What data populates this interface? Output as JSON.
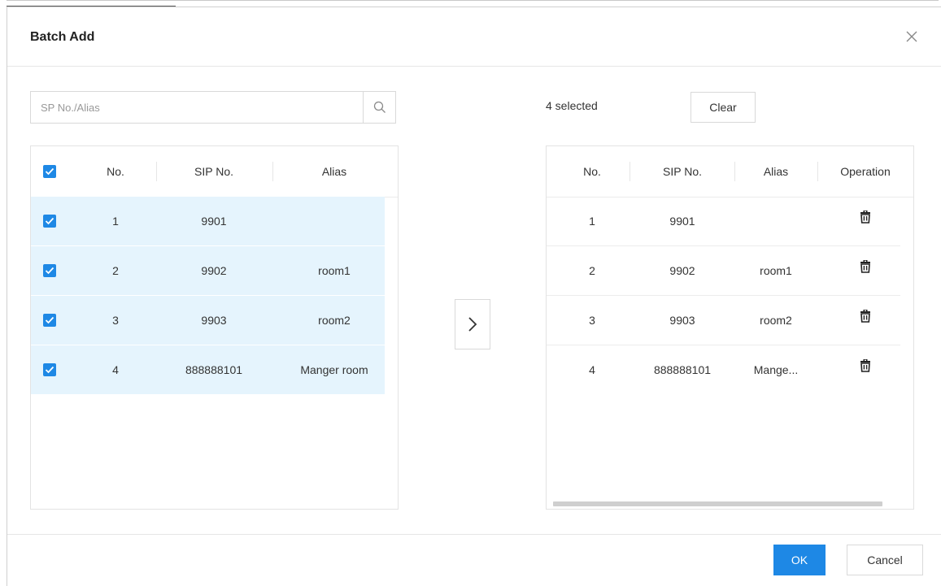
{
  "dialog": {
    "title": "Batch Add",
    "close_icon": "close-icon"
  },
  "search": {
    "placeholder": "SP No./Alias",
    "icon": "search-icon"
  },
  "left_table": {
    "headers": {
      "no": "No.",
      "sip": "SIP No.",
      "alias": "Alias"
    },
    "rows": [
      {
        "no": "1",
        "sip": "9901",
        "alias": "",
        "checked": true
      },
      {
        "no": "2",
        "sip": "9902",
        "alias": "room1",
        "checked": true
      },
      {
        "no": "3",
        "sip": "9903",
        "alias": "room2",
        "checked": true
      },
      {
        "no": "4",
        "sip": "888888101",
        "alias": "Manger room",
        "checked": true
      }
    ]
  },
  "transfer": {
    "icon": "chevron-right-icon"
  },
  "selected": {
    "count_text": "4 selected",
    "clear_label": "Clear"
  },
  "right_table": {
    "headers": {
      "no": "No.",
      "sip": "SIP No.",
      "alias": "Alias",
      "operation": "Operation"
    },
    "rows": [
      {
        "no": "1",
        "sip": "9901",
        "alias": "",
        "op_icon": "trash-icon"
      },
      {
        "no": "2",
        "sip": "9902",
        "alias": "room1",
        "op_icon": "trash-icon"
      },
      {
        "no": "3",
        "sip": "9903",
        "alias": "room2",
        "op_icon": "trash-icon"
      },
      {
        "no": "4",
        "sip": "888888101",
        "alias": "Mange...",
        "op_icon": "trash-icon"
      }
    ]
  },
  "footer": {
    "ok_label": "OK",
    "cancel_label": "Cancel"
  },
  "colors": {
    "accent": "#1e88e5",
    "row_highlight": "#e5f4fd"
  }
}
